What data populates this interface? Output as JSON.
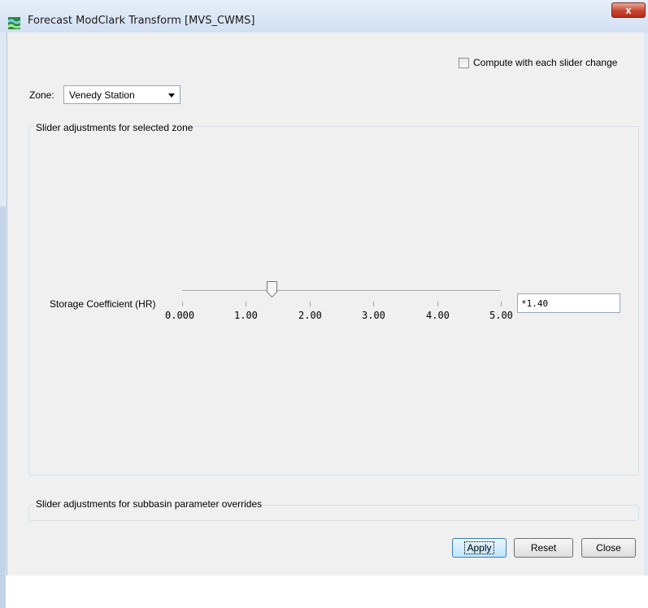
{
  "window": {
    "title": "Forecast ModClark Transform [MVS_CWMS]",
    "close_label": "x",
    "accent_color": "#c7452f"
  },
  "options": {
    "compute_label": "Compute with each slider change",
    "compute_checked": false
  },
  "zone": {
    "label": "Zone:",
    "selected": "Venedy Station"
  },
  "group_selected_zone": {
    "title": "Slider adjustments for selected zone",
    "slider": {
      "label": "Storage Coefficient (HR)",
      "min": 0.0,
      "max": 5.0,
      "value": 1.4,
      "ticks": [
        "0.000",
        "1.00",
        "2.00",
        "3.00",
        "4.00",
        "5.00"
      ],
      "field_value": "*1.40"
    }
  },
  "group_overrides": {
    "title": "Slider adjustments for subbasin parameter overrides"
  },
  "buttons": {
    "apply": "Apply",
    "reset": "Reset",
    "close": "Close"
  }
}
